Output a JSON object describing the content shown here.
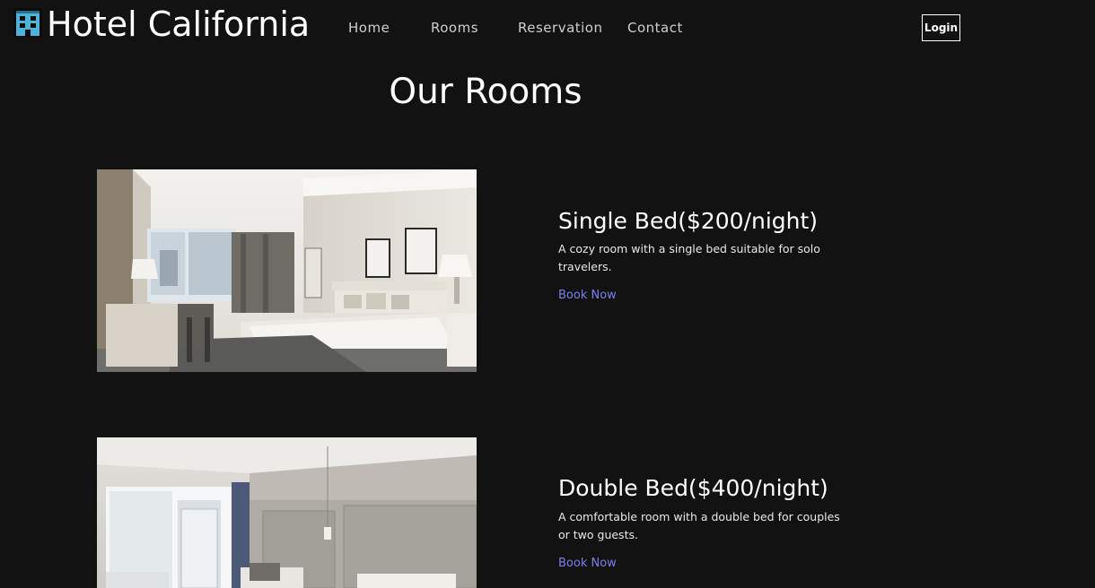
{
  "header": {
    "brand": "Hotel California",
    "nav": [
      {
        "label": "Home"
      },
      {
        "label": "Rooms"
      },
      {
        "label": "Reservation"
      },
      {
        "label": "Contact"
      }
    ],
    "login_label": "Login"
  },
  "main": {
    "title": "Our Rooms",
    "rooms": [
      {
        "name": "Single Bed($200/night)",
        "description": "A cozy room with a single bed suitable for solo travelers.",
        "cta": "Book Now"
      },
      {
        "name": "Double Bed($400/night)",
        "description": "A comfortable room with a double bed for couples or two guests.",
        "cta": "Book Now"
      }
    ]
  },
  "colors": {
    "background": "#121212",
    "text": "#ffffff",
    "link": "#7b7ff2",
    "logo_accent": "#4fb3d9"
  }
}
